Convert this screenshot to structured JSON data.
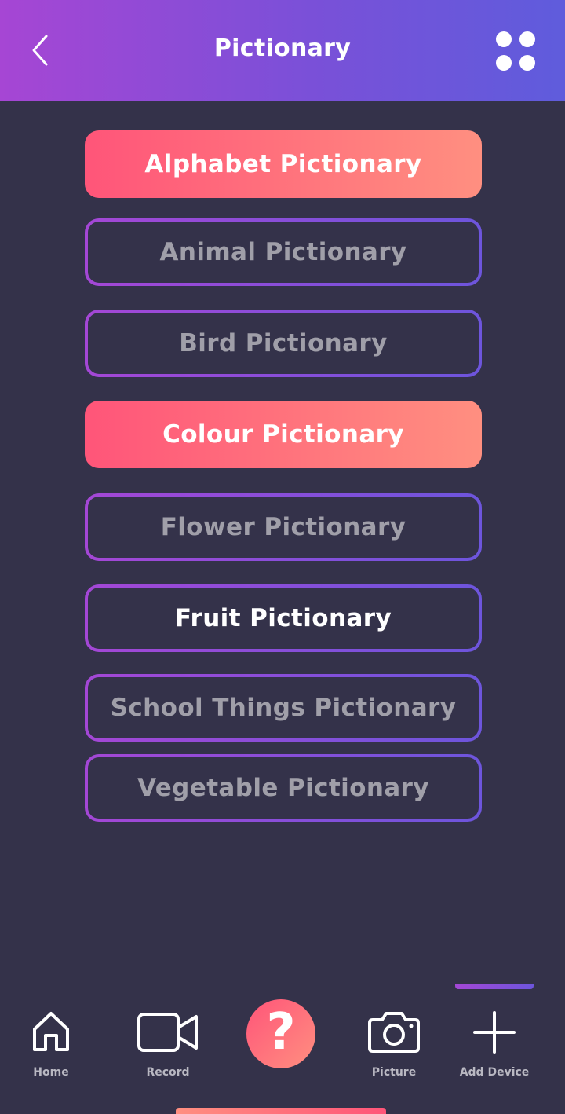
{
  "header": {
    "title": "Pictionary",
    "back_icon": "chevron-left-icon",
    "menu_icon": "four-dots-menu-icon"
  },
  "categories": [
    {
      "label": "Alphabet Pictionary",
      "style": "filled"
    },
    {
      "label": "Animal Pictionary",
      "style": "outline"
    },
    {
      "label": "Bird Pictionary",
      "style": "outline"
    },
    {
      "label": "Colour Pictionary",
      "style": "filled"
    },
    {
      "label": "Flower Pictionary",
      "style": "outline"
    },
    {
      "label": "Fruit Pictionary",
      "style": "outline-active"
    },
    {
      "label": "School Things Pictionary",
      "style": "outline"
    },
    {
      "label": "Vegetable Pictionary",
      "style": "outline"
    }
  ],
  "bottom_nav": {
    "items": [
      {
        "label": "Home",
        "icon": "home-icon"
      },
      {
        "label": "Record",
        "icon": "video-camera-icon"
      },
      {
        "label": "?",
        "icon": "question-icon"
      },
      {
        "label": "Picture",
        "icon": "camera-icon"
      },
      {
        "label": "Add Device",
        "icon": "plus-icon"
      }
    ]
  },
  "colors": {
    "background": "#34324a",
    "header_gradient_start": "#a646d4",
    "header_gradient_end": "#5f5cdc",
    "accent_gradient_start": "#ff5579",
    "accent_gradient_end": "#ff8f80",
    "outline_gradient_start": "#a447d6",
    "outline_gradient_end": "#6d55dc",
    "muted_text": "#a09fa9"
  }
}
